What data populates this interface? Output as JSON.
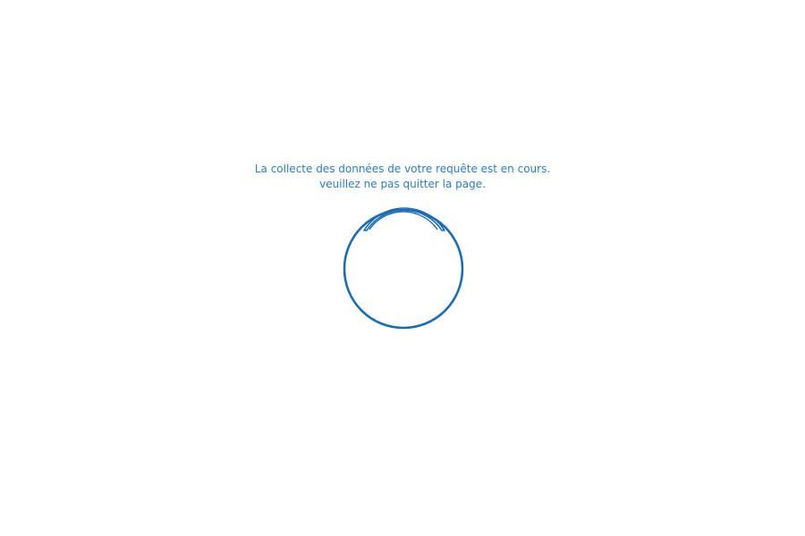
{
  "loading": {
    "message_line1": "La collecte des données de votre requête est en cours.",
    "message_line2": "veuillez ne pas quitter la page.",
    "spinner_icon": "loading-spinner-icon"
  },
  "colors": {
    "text": "#2a7fc4",
    "spinner": "#1a6db5",
    "background": "#ffffff"
  }
}
